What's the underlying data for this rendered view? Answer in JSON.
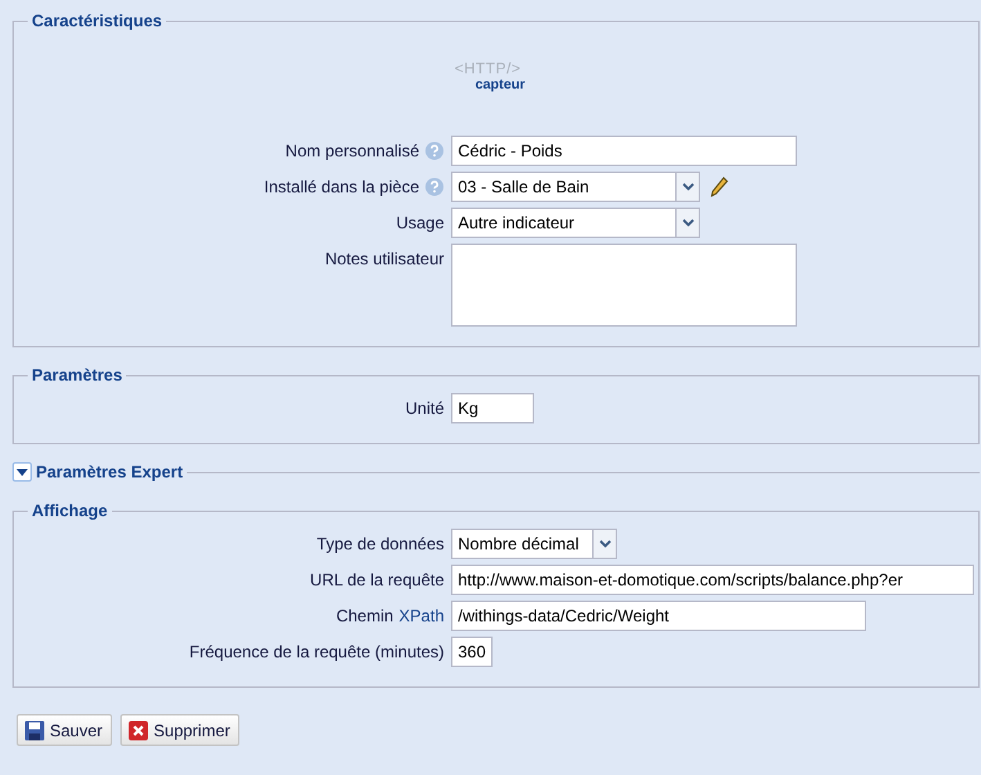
{
  "sections": [
    {
      "title": "Caractéristiques",
      "logo": {
        "text": "<HTTP/>",
        "caption": "capteur"
      },
      "fields": [
        {
          "label": "Nom personnalisé",
          "help": true,
          "kind": "text",
          "value": "Cédric - Poids"
        },
        {
          "label": "Installé dans la pièce",
          "help": true,
          "kind": "combo",
          "value": "03 - Salle de Bain",
          "edit_button": true
        },
        {
          "label": "Usage",
          "kind": "combo",
          "value": "Autre indicateur"
        },
        {
          "label": "Notes utilisateur",
          "kind": "textarea"
        }
      ]
    },
    {
      "title": "Paramètres",
      "fields": [
        {
          "label": "Unité",
          "kind": "text",
          "value": "Kg"
        }
      ]
    },
    {
      "title": "Paramètres Expert",
      "collapsible": true,
      "expanded": false
    },
    {
      "title": "Affichage",
      "fields": [
        {
          "label": "Type de données",
          "kind": "combo",
          "value": "Nombre décimal"
        },
        {
          "label": "URL de la requête",
          "kind": "text",
          "value": "http://www.maison-et-domotique.com/scripts/balance.php?er"
        },
        {
          "label": "Chemin",
          "link": "XPath",
          "kind": "text",
          "value": "/withings-data/Cedric/Weight"
        },
        {
          "label": "Fréquence de la requête (minutes)",
          "kind": "text",
          "value": "360"
        }
      ]
    }
  ],
  "buttons": [
    {
      "kind": "save",
      "label": "Sauver"
    },
    {
      "kind": "delete",
      "label": "Supprimer"
    }
  ]
}
